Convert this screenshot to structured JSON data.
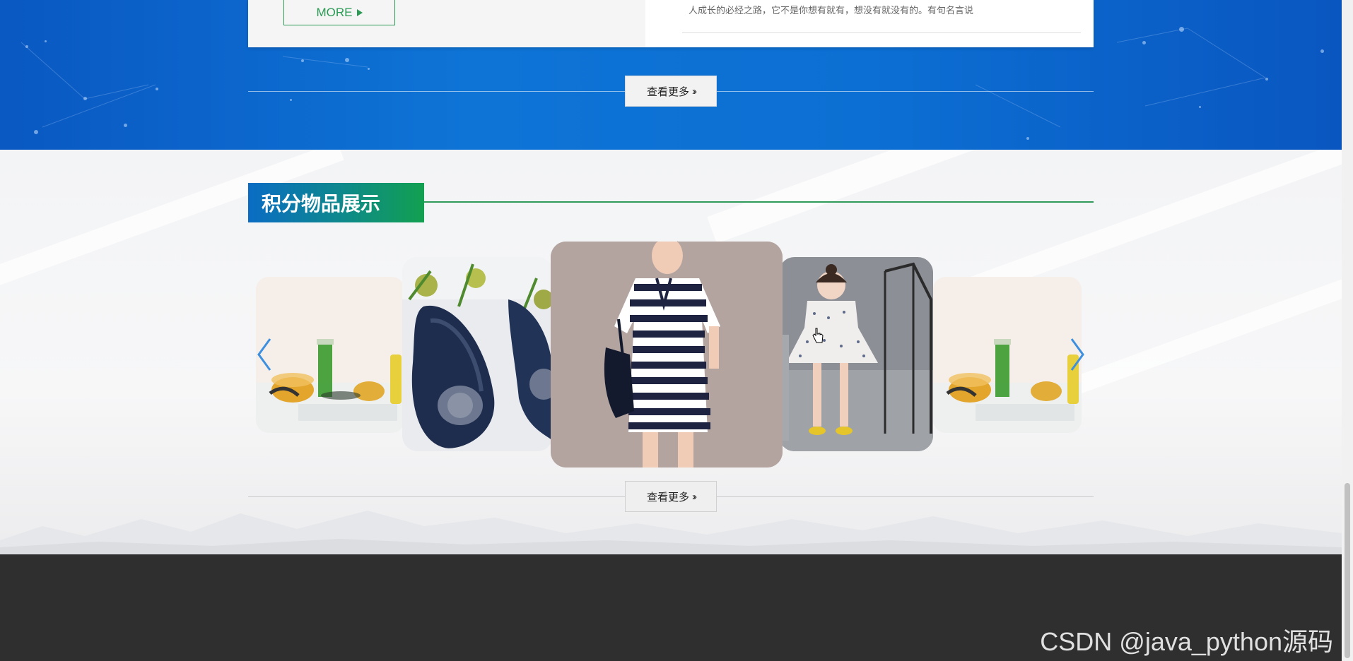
{
  "news": {
    "more_label": "MORE",
    "snippet": "人成长的必经之路，它不是你想有就有，想没有就没有的。有句名言说",
    "view_more_label": "查看更多"
  },
  "products_section": {
    "title": "积分物品展示",
    "view_more_label": "查看更多",
    "slides": [
      {
        "name": "drinks-glasses",
        "position": "far-left"
      },
      {
        "name": "navy-shoes",
        "position": "left"
      },
      {
        "name": "striped-dress",
        "position": "center"
      },
      {
        "name": "polka-dot-dress",
        "position": "right"
      },
      {
        "name": "drinks-glasses",
        "position": "far-right"
      }
    ]
  },
  "icons": {
    "prev": "chevron-left-icon",
    "next": "chevron-right-icon",
    "cursor": "hand-pointer-icon",
    "more_arrow": "triangle-right-icon",
    "view_more_arrow": "double-chevron-right-icon"
  },
  "colors": {
    "brand_green": "#2a9a55",
    "band_blue": "#0e74d6",
    "footer": "#2f2f2f",
    "arrow_blue": "#3d8fe0"
  },
  "watermark": "CSDN @java_python源码"
}
